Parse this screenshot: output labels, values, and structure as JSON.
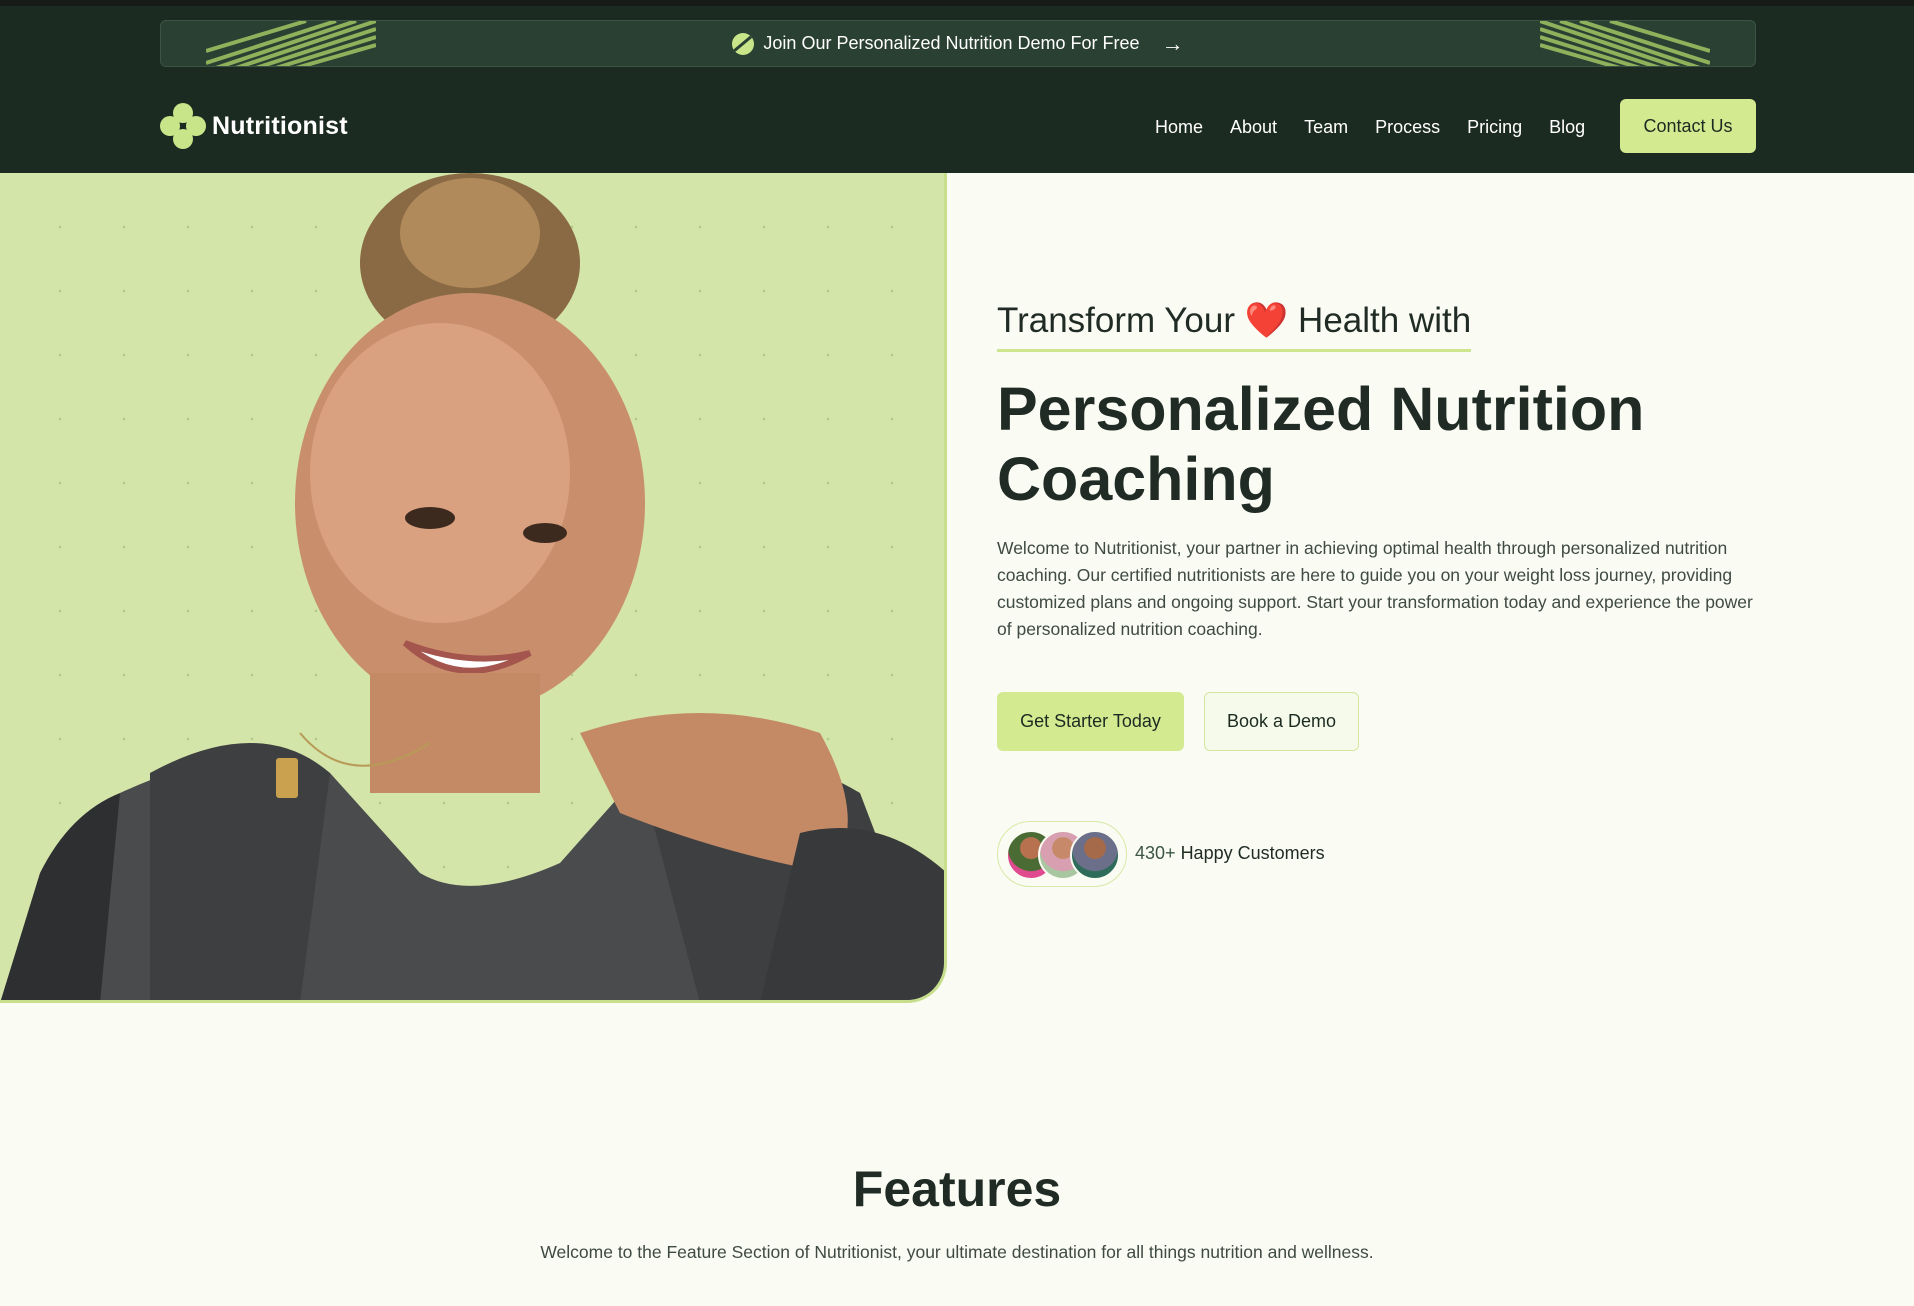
{
  "promo": {
    "text": "Join Our Personalized Nutrition Demo For Free",
    "icon": "leaf-badge-icon",
    "arrow_icon": "arrow-right-icon"
  },
  "brand": {
    "name": "Nutritionist",
    "logo_icon": "clover-logo-icon",
    "accent": "#d3ea90",
    "dark": "#1c2b22"
  },
  "nav": {
    "items": [
      "Home",
      "About",
      "Team",
      "Process",
      "Pricing",
      "Blog"
    ],
    "contact_label": "Contact Us"
  },
  "hero": {
    "tagline_before": "Transform Your",
    "tagline_emoji": "❤️",
    "tagline_after": "Health with",
    "headline": "Personalized Nutrition Coaching",
    "intro": "Welcome to Nutritionist, your partner in achieving optimal health through personalized nutrition coaching. Our certified nutritionists are here to guide you on your weight loss journey, providing customized plans and ongoing support. Start your transformation today and experience the power of personalized nutrition coaching.",
    "primary_cta": "Get Starter Today",
    "secondary_cta": "Book a Demo",
    "customers_count": "430+",
    "customers_label": "Happy Customers"
  },
  "features": {
    "title": "Features",
    "subtitle": "Welcome to the Feature Section of Nutritionist, your ultimate destination for all things nutrition and wellness."
  }
}
